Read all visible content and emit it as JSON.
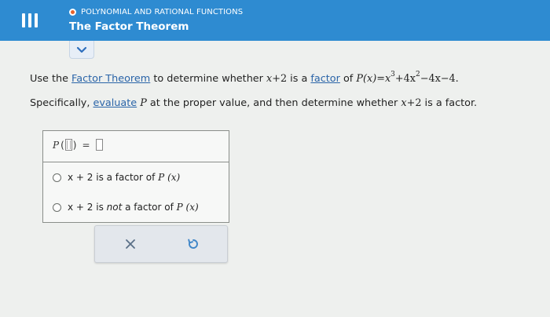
{
  "header": {
    "topic": "POLYNOMIAL AND RATIONAL FUNCTIONS",
    "title": "The Factor Theorem",
    "accent_color": "#2e8bd1",
    "topic_dot_color": "#e8632b"
  },
  "question": {
    "line1": {
      "prefix": "Use the ",
      "link1": "Factor Theorem",
      "middle1": " to determine whether ",
      "expr_x": "x",
      "expr_rest": "+2",
      "middle2": " is a ",
      "link2": "factor",
      "middle3": " of ",
      "px": "P",
      "px_arg": "(x)",
      "equals": "=",
      "t1_base": "x",
      "t1_exp": "3",
      "t2": "+4x",
      "t2_exp": "2",
      "t3": "−4x−4."
    },
    "line2": {
      "prefix": "Specifically, ",
      "link": "evaluate",
      "middle1": " ",
      "p": "P",
      "middle2": " at the proper value, and then determine whether ",
      "x": "x",
      "rest": "+2",
      "suffix": " is a factor."
    }
  },
  "answer": {
    "eval_p": "P",
    "eval_open": "(",
    "eval_close": ")",
    "eval_eq": "=",
    "choice1": {
      "prefix": "x + 2 is a factor of ",
      "func": "P",
      "arg": "(x)"
    },
    "choice2": {
      "prefix": "x + 2 is ",
      "emph": "not",
      "middle": " a factor of ",
      "func": "P",
      "arg": "(x)"
    }
  },
  "icons": {
    "menu": "hamburger-menu-icon",
    "expand": "chevron-down-icon",
    "clear": "x-icon",
    "reset": "undo-icon"
  }
}
